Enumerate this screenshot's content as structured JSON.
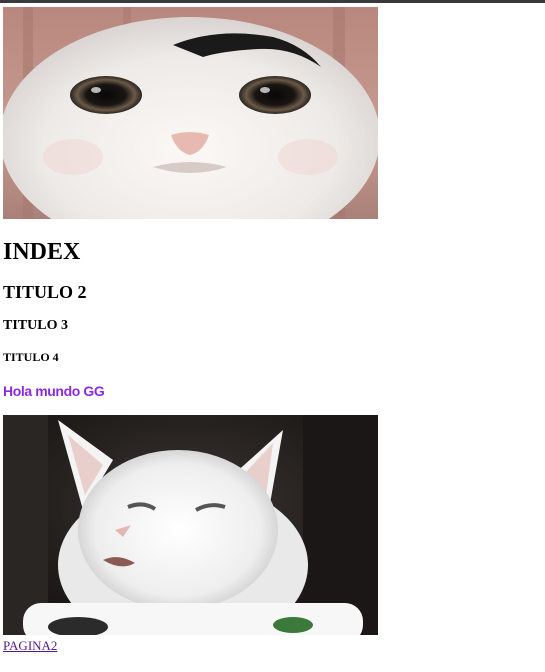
{
  "page": {
    "title_h1": "INDEX",
    "title_h2": "TITULO 2",
    "title_h3": "TITULO 3",
    "title_h4": "TITULO 4",
    "subtitle": "Hola mundo GG",
    "link_label": "PAGINA2"
  },
  "colors": {
    "subtitle": "#8a2be2",
    "link": "#551a8b"
  },
  "images": {
    "first": "cat-face-photo",
    "second": "white-cat-at-table-photo"
  }
}
